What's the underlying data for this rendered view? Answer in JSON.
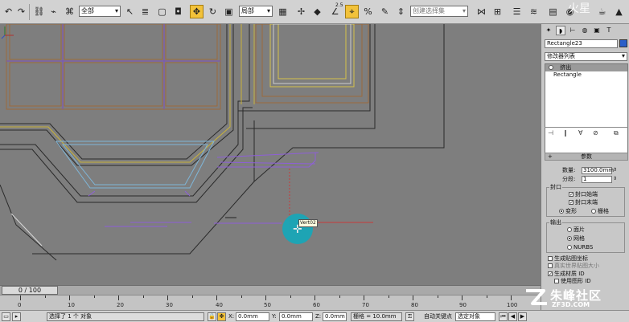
{
  "toolbar": {
    "selection_filter": "全部",
    "reference_coord": "局部",
    "named_selection_placeholder": "创建选择集",
    "snap_label": "2.5",
    "tools": [
      "undo-icon",
      "redo-icon",
      "select-link-icon",
      "unlink-icon",
      "bind-spacewarp-icon",
      "select-object-icon",
      "select-by-name-icon",
      "rect-region-icon",
      "window-crossing-icon",
      "select-move-icon",
      "select-rotate-icon",
      "select-scale-icon",
      "pivot-icon",
      "manipulate-icon",
      "snap-toggle-icon",
      "angle-snap-icon",
      "percent-snap-icon",
      "spinner-snap-icon",
      "edit-named-sel-icon",
      "mirror-icon",
      "align-icon",
      "layer-icon",
      "curve-editor-icon",
      "schematic-icon",
      "material-editor-icon",
      "render-setup-icon",
      "render-icon"
    ]
  },
  "viewport": {
    "snap_tooltip": "Vert02",
    "background": "#7e7e7e",
    "accent_cursor": "#16a7b9"
  },
  "timeline": {
    "frame_slider": "0 / 100",
    "ticks": [
      "0",
      "10",
      "20",
      "30",
      "40",
      "50",
      "60",
      "70",
      "80",
      "90",
      "100"
    ]
  },
  "status": {
    "selection_text": "选择了 1 个 对象",
    "x_label": "X:",
    "x_value": "0.0mm",
    "y_label": "Y:",
    "y_value": "0.0mm",
    "z_label": "Z:",
    "z_value": "0.0mm",
    "grid_text": "栅格 = 10.0mm",
    "auto_key": "自动关键点",
    "selected_object": "选定对象"
  },
  "panel": {
    "object_name": "Rectangle23",
    "modifier_list": "修改器列表",
    "stack_items": [
      "挤出",
      "Rectangle"
    ],
    "rollout_title": "参数",
    "amount_label": "数量:",
    "amount_value": "3100.0mm",
    "segments_label": "分段:",
    "segments_value": "1",
    "capping_title": "封口",
    "cap_start": "封口始端",
    "cap_end": "封口末端",
    "morph": "变形",
    "grid": "栅格",
    "output_title": "输出",
    "out_patch": "面片",
    "out_mesh": "网格",
    "out_nurbs": "NURBS",
    "gen_mapping": "生成贴图坐标",
    "real_world": "真实世界贴图大小",
    "gen_matid": "生成材质 ID",
    "use_shape_ids": "使用图形 ID"
  },
  "watermark": {
    "top": "火星",
    "brand": "朱峰社区",
    "site": "ZF3D.COM"
  }
}
